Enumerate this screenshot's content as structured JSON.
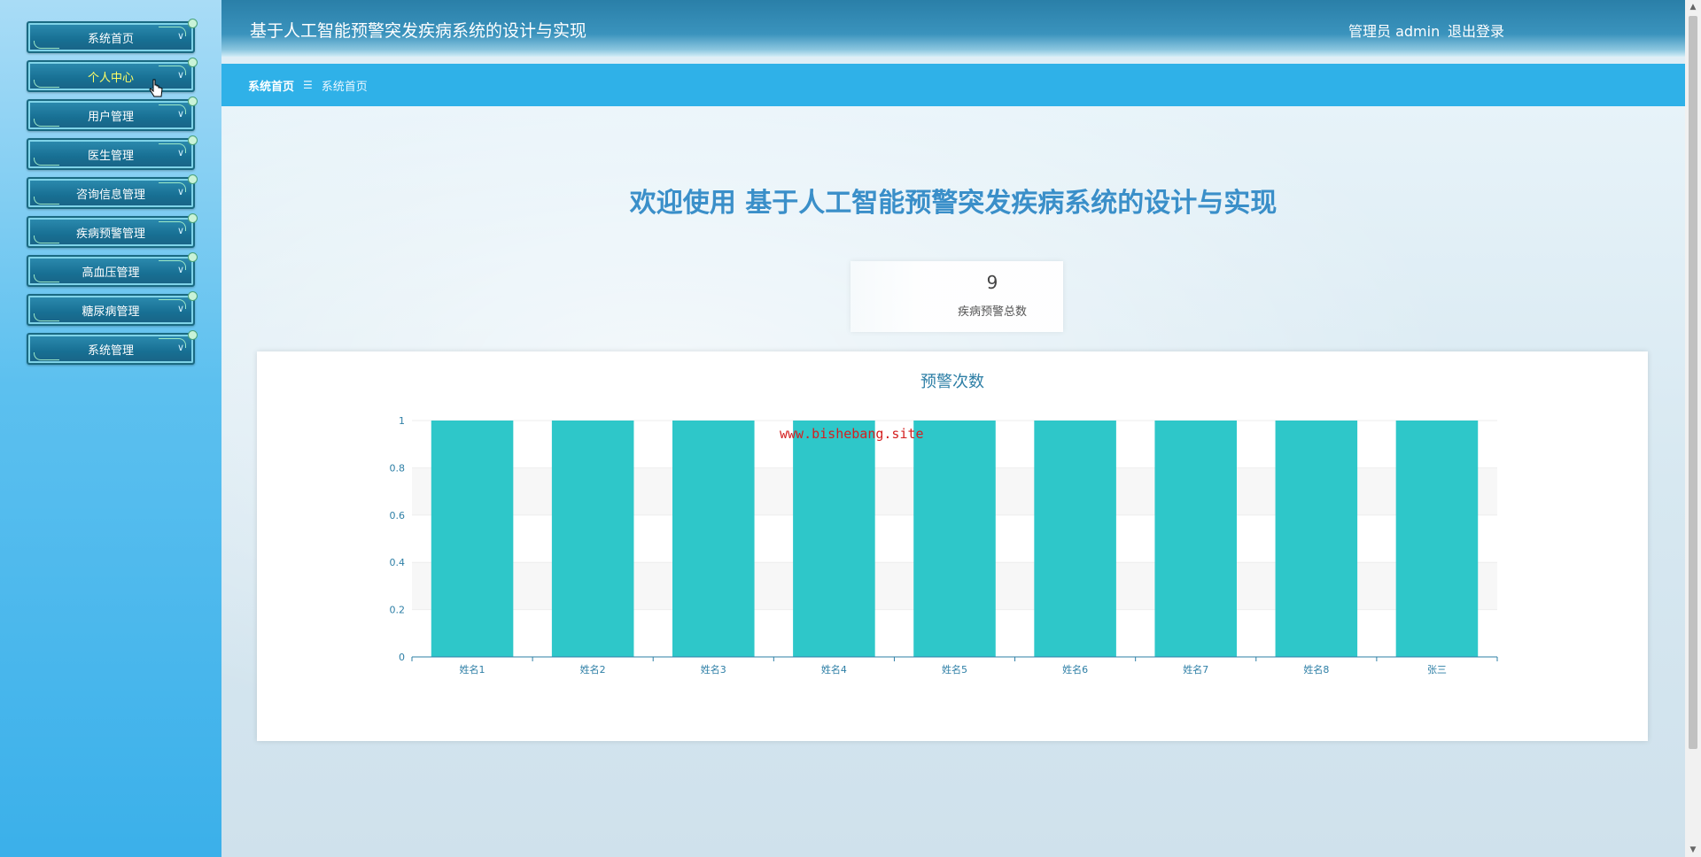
{
  "sidebar": {
    "items": [
      {
        "label": "系统首页",
        "name": "sidebar-item-home"
      },
      {
        "label": "个人中心",
        "name": "sidebar-item-profile",
        "active": true
      },
      {
        "label": "用户管理",
        "name": "sidebar-item-users"
      },
      {
        "label": "医生管理",
        "name": "sidebar-item-doctors"
      },
      {
        "label": "咨询信息管理",
        "name": "sidebar-item-consultation"
      },
      {
        "label": "疾病预警管理",
        "name": "sidebar-item-disease-warning"
      },
      {
        "label": "高血压管理",
        "name": "sidebar-item-hypertension"
      },
      {
        "label": "糖尿病管理",
        "name": "sidebar-item-diabetes"
      },
      {
        "label": "系统管理",
        "name": "sidebar-item-system"
      }
    ]
  },
  "header": {
    "title": "基于人工智能预警突发疾病系统的设计与实现",
    "user": "管理员 admin",
    "logout": "退出登录"
  },
  "breadcrumb": {
    "home": "系统首页",
    "separator": "☰",
    "current": "系统首页"
  },
  "main": {
    "welcome": "欢迎使用 基于人工智能预警突发疾病系统的设计与实现",
    "stat": {
      "value": "9",
      "label": "疾病预警总数"
    },
    "watermark": "www.bishebang.site"
  },
  "colors": {
    "bar": "#2ec7c9",
    "axis": "#2e7fa6",
    "title": "#3a8fc9"
  },
  "chart_data": {
    "type": "bar",
    "title": "预警次数",
    "categories": [
      "姓名1",
      "姓名2",
      "姓名3",
      "姓名4",
      "姓名5",
      "姓名6",
      "姓名7",
      "姓名8",
      "张三"
    ],
    "values": [
      1,
      1,
      1,
      1,
      1,
      1,
      1,
      1,
      1
    ],
    "ylim": [
      0,
      1
    ],
    "yticks": [
      0,
      0.2,
      0.4,
      0.6,
      0.8,
      1
    ],
    "xlabel": "",
    "ylabel": "",
    "grid": true
  }
}
